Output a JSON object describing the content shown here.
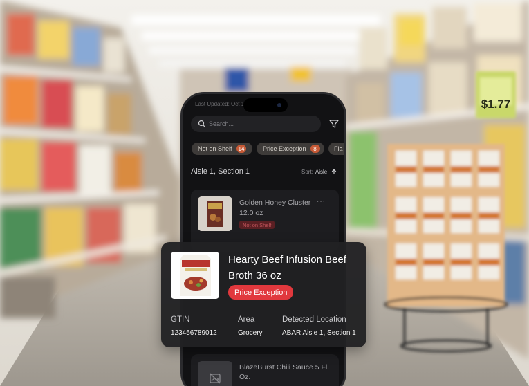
{
  "status_bar": {
    "text": "Last Updated: Oct 13, 2023"
  },
  "search": {
    "placeholder": "Search..."
  },
  "filter_chips": [
    {
      "label": "Not on Shelf",
      "count": "14"
    },
    {
      "label": "Price Exception",
      "count": "8"
    },
    {
      "label": "Fla"
    }
  ],
  "section": {
    "title": "Aisle 1, Section 1",
    "sort_label": "Sort:",
    "sort_value": "Aisle"
  },
  "items": [
    {
      "title": "Golden Honey Cluster",
      "size": "12.0 oz",
      "badge": "Not on Shelf"
    },
    {
      "title": "BlazeBurst Chili Sauce 5 Fl. Oz."
    }
  ],
  "popup": {
    "title": "Hearty Beef Infusion Beef Broth 36 oz",
    "badge": "Price Exception",
    "gtin_label": "GTIN",
    "gtin_value": "123456789012",
    "area_label": "Area",
    "area_value": "Grocery",
    "location_label": "Detected Location",
    "location_value": "ABAR Aisle 1, Section 1"
  },
  "price_tag": "$1.77",
  "colors": {
    "phone_bg": "#121214",
    "chip_bg": "#3e3b39",
    "chip_count": "#c75a36",
    "badge_red": "#e1383d",
    "popup_bg": "#212123"
  },
  "icons": [
    "search-icon",
    "filter-icon",
    "sort-arrow-icon",
    "image-placeholder-icon"
  ]
}
